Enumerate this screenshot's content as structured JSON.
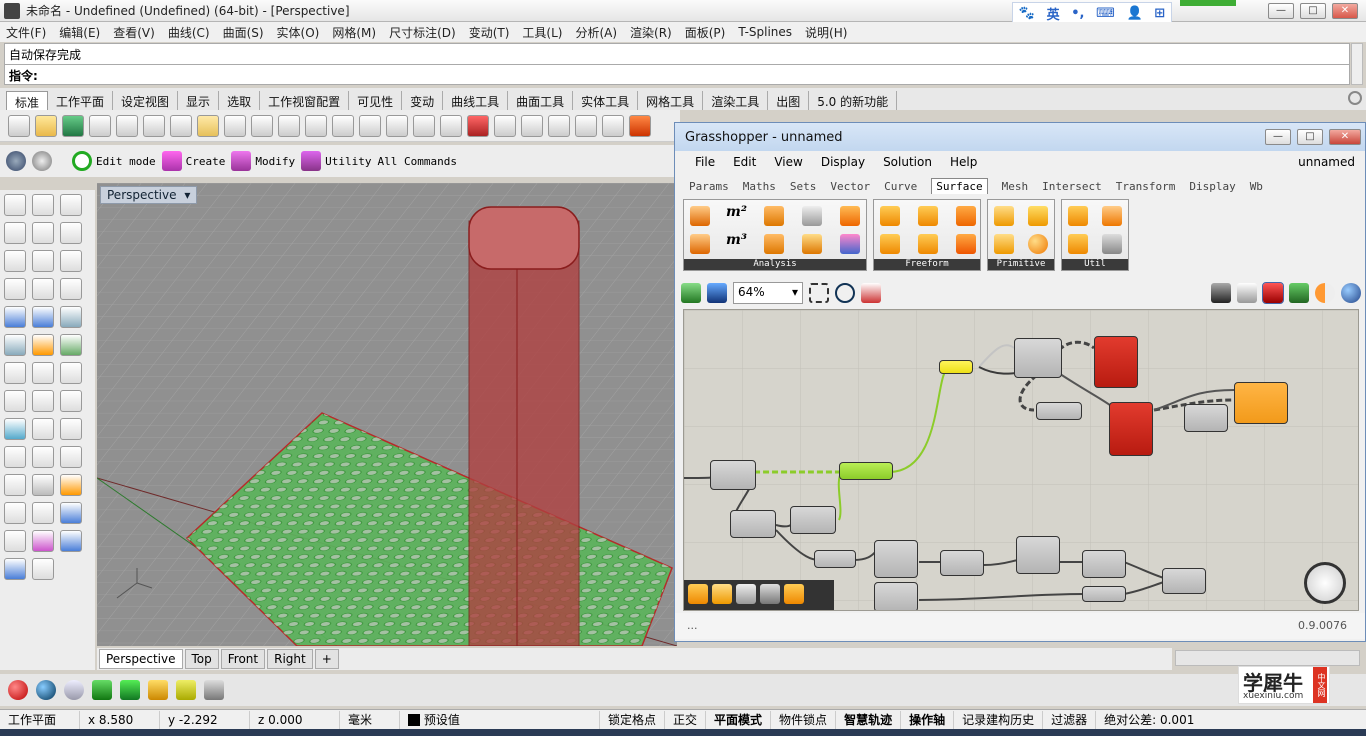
{
  "window": {
    "title": "未命名 - Undefined (Undefined) (64-bit) - [Perspective]",
    "min": "—",
    "max": "□",
    "close": "✕"
  },
  "ime": {
    "items": [
      "英",
      "•,",
      "⌨",
      "👤",
      "⊞"
    ]
  },
  "menu": [
    "文件(F)",
    "编辑(E)",
    "查看(V)",
    "曲线(C)",
    "曲面(S)",
    "实体(O)",
    "网格(M)",
    "尺寸标注(D)",
    "变动(T)",
    "工具(L)",
    "分析(A)",
    "渲染(R)",
    "面板(P)",
    "T-Splines",
    "说明(H)"
  ],
  "command": {
    "history": "自动保存完成",
    "prompt": "指令:"
  },
  "tabs": [
    "标准",
    "工作平面",
    "设定视图",
    "显示",
    "选取",
    "工作视窗配置",
    "可见性",
    "变动",
    "曲线工具",
    "曲面工具",
    "实体工具",
    "网格工具",
    "渲染工具",
    "出图",
    "5.0 的新功能"
  ],
  "tsplines": {
    "edit": "Edit mode",
    "create": "Create",
    "modify": "Modify",
    "utility": "Utility",
    "all": "All Commands"
  },
  "viewport": {
    "label": "Perspective",
    "tabs": [
      "Perspective",
      "Top",
      "Front",
      "Right"
    ],
    "add": "+"
  },
  "status": {
    "cplane": "工作平面",
    "x": "x 8.580",
    "y": "y -2.292",
    "z": "z 0.000",
    "units": "毫米",
    "layer": "预设值",
    "toggles": [
      "锁定格点",
      "正交",
      "平面模式",
      "物件锁点",
      "智慧轨迹",
      "操作轴",
      "记录建构历史",
      "过滤器"
    ],
    "tolerance": "绝对公差: 0.001"
  },
  "watermark": {
    "text": "学犀牛",
    "sub": "xuexiniu.com",
    "badge": "中文网"
  },
  "grasshopper": {
    "title": "Grasshopper - unnamed",
    "doc": "unnamed",
    "menu": [
      "File",
      "Edit",
      "View",
      "Display",
      "Solution",
      "Help"
    ],
    "tabs": [
      "Params",
      "Maths",
      "Sets",
      "Vector",
      "Curve",
      "Surface",
      "Mesh",
      "Intersect",
      "Transform",
      "Display",
      "Wb"
    ],
    "active_tab": "Surface",
    "groups": [
      "Analysis",
      "Freeform",
      "Primitive",
      "Util"
    ],
    "zoom": "64%",
    "version": "0.9.0076",
    "ellipsis": "...",
    "m2": "m²",
    "m3": "m³"
  }
}
